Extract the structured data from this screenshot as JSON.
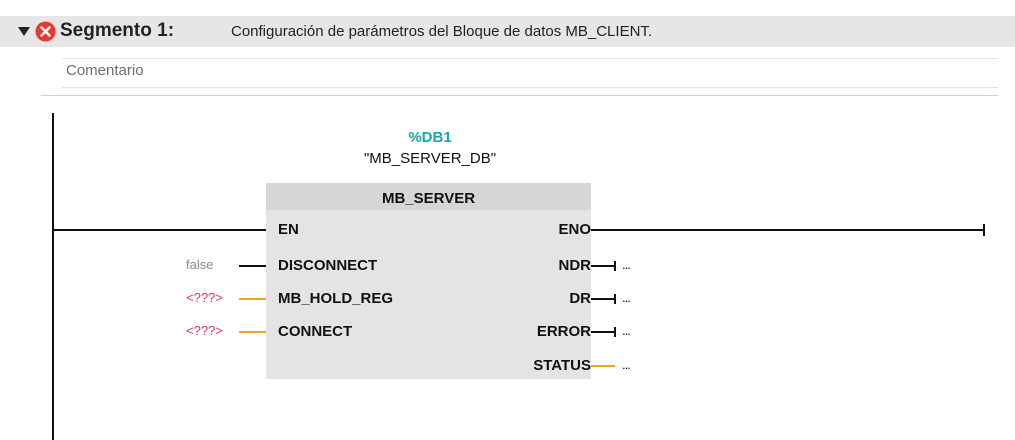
{
  "segment": {
    "caret_icon": "expand-triangle-icon",
    "status_icon": "error-icon",
    "status_color": "#e8392e",
    "title": "Segmento 1:",
    "description": "Configuración de parámetros del Bloque de datos MB_CLIENT.",
    "comment_placeholder": "Comentario"
  },
  "block": {
    "instance_address": "%DB1",
    "instance_name": "\"MB_SERVER_DB\"",
    "type_name": "MB_SERVER",
    "inputs": [
      {
        "name": "EN",
        "actual": ""
      },
      {
        "name": "DISCONNECT",
        "actual": "false"
      },
      {
        "name": "MB_HOLD_REG",
        "actual": "<???>"
      },
      {
        "name": "CONNECT",
        "actual": "<???>"
      }
    ],
    "outputs": [
      {
        "name": "ENO",
        "actual": ""
      },
      {
        "name": "NDR",
        "actual": "..."
      },
      {
        "name": "DR",
        "actual": "..."
      },
      {
        "name": "ERROR",
        "actual": "..."
      },
      {
        "name": "STATUS",
        "actual": "..."
      }
    ]
  },
  "colors": {
    "header_bg": "#e6e6e6",
    "block_bg": "#e4e4e4",
    "address_color": "#1ba6a6",
    "missing_param_color": "#e0306c",
    "wire_orange": "#f0a422",
    "constant_color": "#8a8a8a"
  }
}
